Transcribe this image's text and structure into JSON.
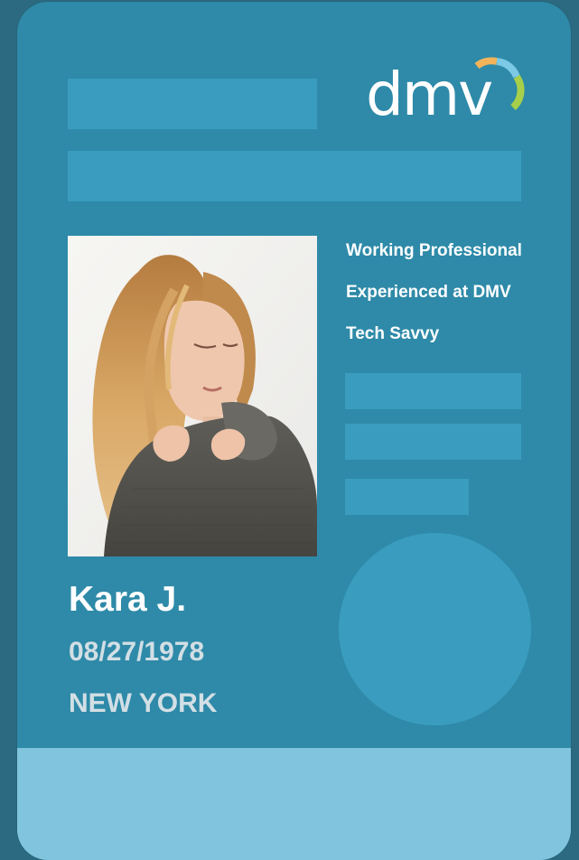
{
  "card": {
    "logo": {
      "text": "dmv",
      "arc_colors": [
        "#f2b35b",
        "#7cc9e6",
        "#a8cf4a"
      ]
    },
    "traits": [
      "Working Professional",
      "Experienced at DMV",
      "Tech Savvy"
    ],
    "holder": {
      "name": "Kara J.",
      "dob": "08/27/1978",
      "state": "NEW YORK"
    },
    "colors": {
      "card_background": "#2e8aa8",
      "placeholder": "#3a9dbf",
      "footer": "#80c4dd",
      "page_background": "#2b6a80"
    }
  }
}
